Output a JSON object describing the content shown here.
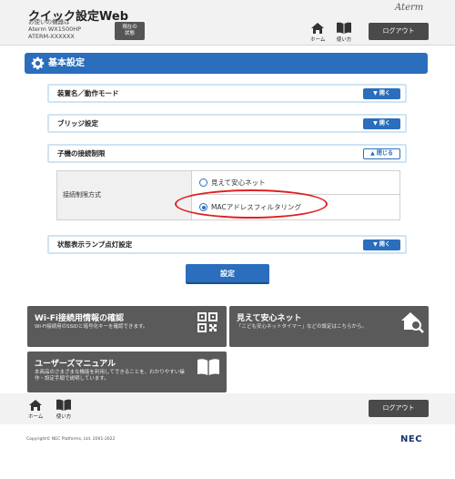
{
  "header": {
    "app_title": "クイック設定Web",
    "device_lines": [
      "お使いの機器は",
      "Aterm WX1500HP",
      "ATERM-XXXXXX"
    ],
    "status_button": "現在の\n状態",
    "brand": "Aterm",
    "home_label": "ホーム",
    "help_label": "使い方",
    "logout_label": "ログアウト"
  },
  "section": {
    "title": "基本設定"
  },
  "accordions": [
    {
      "label": "装置名／動作モード",
      "button": "開く"
    },
    {
      "label": "ブリッジ設定",
      "button": "開く"
    },
    {
      "label": "子機の接続制限",
      "button": "閉じる"
    },
    {
      "label": "状態表示ランプ点灯設定",
      "button": "開く"
    }
  ],
  "connection_limit": {
    "label": "接続制限方式",
    "options": [
      {
        "label": "見えて安心ネット",
        "selected": false
      },
      {
        "label": "MACアドレスフィルタリング",
        "selected": true
      }
    ]
  },
  "set_button": "設定",
  "tiles": [
    {
      "title": "Wi-Fi接続用情報の確認",
      "desc": [
        "Wi-Fi接続用のSSIDと暗号化キーを確認できます。"
      ],
      "icon": "qr-code-icon"
    },
    {
      "title": "見えて安心ネット",
      "desc": [
        "「こども安心ネットタイマー」などの設定はこちらから。"
      ],
      "icon": "house-search-icon"
    },
    {
      "title": "ユーザーズマニュアル",
      "desc": [
        "本商品のさまざまな機能を利用してできることを、わかりやすい操",
        "作・設定手順で説明しています。"
      ],
      "icon": "book-icon"
    }
  ],
  "footer": {
    "home_label": "ホーム",
    "help_label": "使い方",
    "logout_label": "ログアウト",
    "copyright": "Copyright© NEC Platforms, Ltd. 2001-2022",
    "logo": "NEC"
  },
  "colors": {
    "accent": "#2a6ebd",
    "tile_bg": "#5a5a5a",
    "highlight": "#e02020"
  }
}
